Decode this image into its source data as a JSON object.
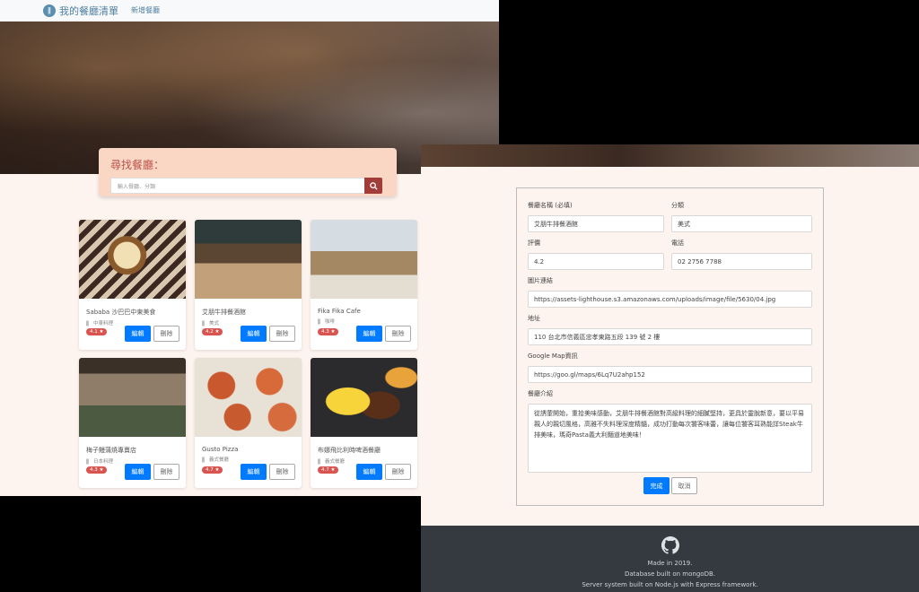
{
  "nav": {
    "brand": "我的餐廳清單",
    "new_link": "新增餐廳"
  },
  "search": {
    "title": "尋找餐廳：",
    "placeholder": "輸入餐廳、分類"
  },
  "cards": [
    {
      "name": "Sababa 沙巴巴中東美食",
      "category": "中東料理",
      "rating": "4.1 ★",
      "edit": "編輯",
      "delete": "刪除"
    },
    {
      "name": "艾朋牛排餐酒館",
      "category": "美式",
      "rating": "4.2 ★",
      "edit": "編輯",
      "delete": "刪除"
    },
    {
      "name": "Fika Fika Cafe",
      "category": "咖啡",
      "rating": "4.3 ★",
      "edit": "編輯",
      "delete": "刪除"
    },
    {
      "name": "梅子鰻蒲燒專賣店",
      "category": "日本料理",
      "rating": "4.3 ★",
      "edit": "編輯",
      "delete": "刪除"
    },
    {
      "name": "Gusto Pizza",
      "category": "義式餐廳",
      "rating": "4.7 ★",
      "edit": "編輯",
      "delete": "刪除"
    },
    {
      "name": "布娜飛比利時啤酒餐廳",
      "category": "義式餐廳",
      "rating": "4.7 ★",
      "edit": "編輯",
      "delete": "刪除"
    }
  ],
  "form": {
    "name_label": "餐廳名稱 (必填)",
    "name_value": "艾朋牛排餐酒館",
    "category_label": "分類",
    "category_value": "美式",
    "rating_label": "評價",
    "rating_value": "4.2",
    "phone_label": "電話",
    "phone_value": "02 2756 7788",
    "image_label": "圖片連結",
    "image_value": "https://assets-lighthouse.s3.amazonaws.com/uploads/image/file/5630/04.jpg",
    "address_label": "地址",
    "address_value": "110 台北市信義區忠孝東路五段 139 號 2 樓",
    "map_label": "Google Map資訊",
    "map_value": "https://goo.gl/maps/6Lq7U2ahp152",
    "desc_label": "餐廳介紹",
    "desc_value": "從誘葷開始，重拾美味感動，艾朋牛排餐酒館對高級料理的細膩堅持，更具於靈脫新意，要以平易親人的親切風格，高雅不失料理深度精髓，成功打動每次饕客味蕾，讓每位饕客耳熟能詳Steak牛排美味，瑪奇Pasta義大利麵道地美味！",
    "submit": "完成",
    "cancel": "取消"
  },
  "footer": {
    "line1": "Made in 2019.",
    "line2": "Database built on mongoDB.",
    "line3": "Server system built on Node.js with Express framework."
  },
  "colors": {
    "primary": "#007bff",
    "danger": "#d9534f",
    "search_btn": "#a23c38",
    "footer_bg": "#343a40"
  }
}
